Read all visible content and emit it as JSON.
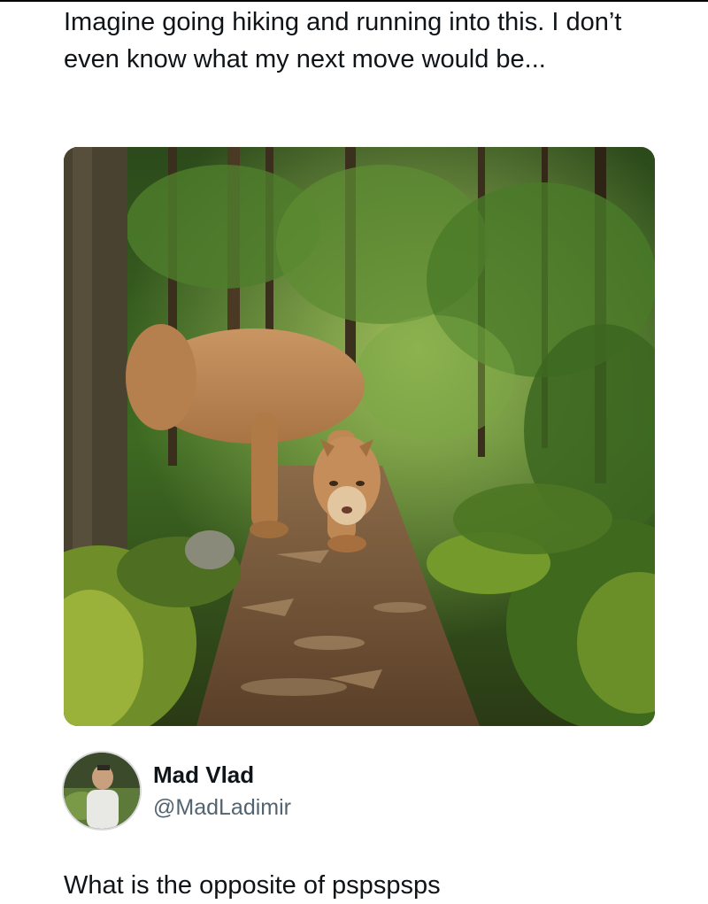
{
  "post": {
    "text": "Imagine going hiking and running into this. I don’t even know what my next move would be...",
    "media_alt": "cougar-on-forest-trail"
  },
  "author": {
    "name": "Mad Vlad",
    "handle": "@MadLadimir"
  },
  "reply": {
    "text": "What is the opposite of pspspsps"
  },
  "colors": {
    "text": "#0f1419",
    "handle": "#536471",
    "background": "#ffffff"
  }
}
